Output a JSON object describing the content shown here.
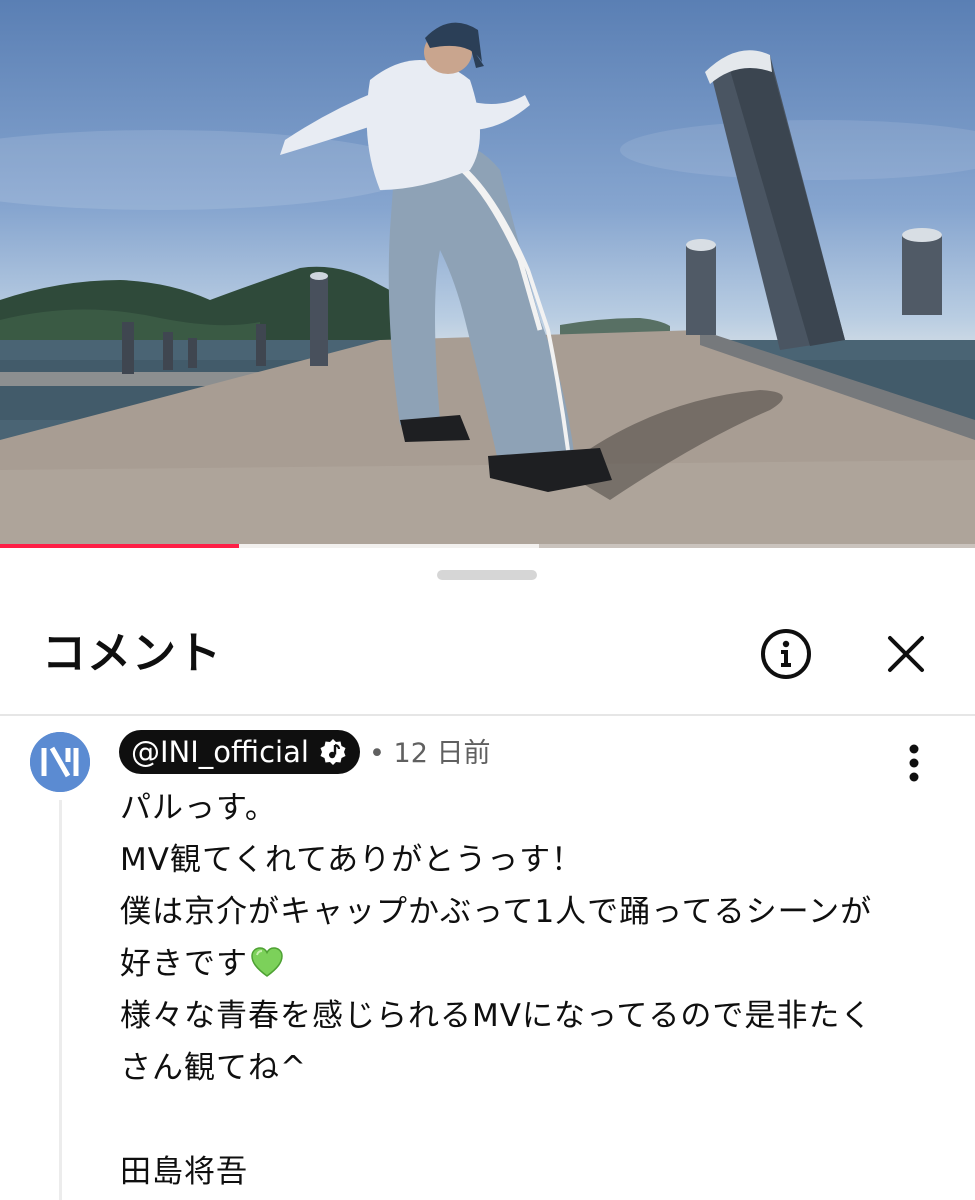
{
  "video": {
    "scene": "video-frame",
    "progress": {
      "played_fraction": 0.245,
      "buffered_fraction": 0.553
    }
  },
  "comments_panel": {
    "title": "コメント",
    "icons": {
      "info": "info-icon",
      "close": "close-icon",
      "more": "more-vert-icon"
    },
    "comment": {
      "author": "@INI_official",
      "verified_icon": "music-note-verified-icon",
      "avatar_icon": "INI-logo",
      "separator": "•",
      "time": "12 日前",
      "lines": [
        "パルっす。",
        "MV観てくれてありがとうっす！",
        "僕は京介がキャップかぶって1人で踊ってるシーンが",
        "好きです",
        "様々な青春を感じられるMVになってるので是非たく",
        "さん観てね^",
        "",
        "田島将吾"
      ],
      "emoji": "💚"
    }
  },
  "colors": {
    "accent_red": "#ff1f47",
    "avatar_blue": "#5b8bd2",
    "chip_black": "#0f0f0f",
    "meta_gray": "#606060",
    "heart_green": "#7cd15a"
  }
}
